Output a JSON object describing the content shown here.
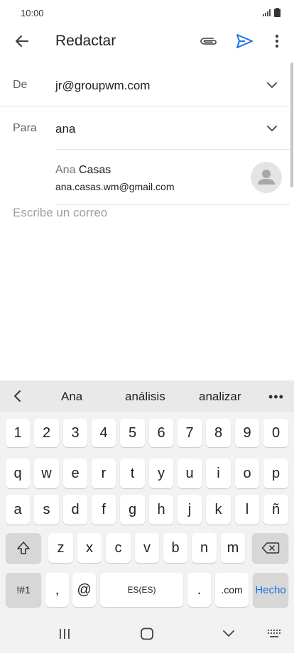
{
  "status_bar": {
    "time": "10:00"
  },
  "app_bar": {
    "title": "Redactar"
  },
  "from_field": {
    "label": "De",
    "value": "jr@groupwm.com"
  },
  "to_field": {
    "label": "Para",
    "value": "ana"
  },
  "suggestion": {
    "name_typed": "Ana",
    "name_rest": " Casas",
    "email": "ana.casas.wm@gmail.com"
  },
  "body": {
    "placeholder": "Escribe un correo"
  },
  "keyboard": {
    "suggestions": [
      "Ana",
      "análisis",
      "analizar"
    ],
    "more_label": "•••",
    "row_numbers": [
      "1",
      "2",
      "3",
      "4",
      "5",
      "6",
      "7",
      "8",
      "9",
      "0"
    ],
    "row1": [
      "q",
      "w",
      "e",
      "r",
      "t",
      "y",
      "u",
      "i",
      "o",
      "p"
    ],
    "row2": [
      "a",
      "s",
      "d",
      "f",
      "g",
      "h",
      "j",
      "k",
      "l",
      "ñ"
    ],
    "row3": [
      "z",
      "x",
      "c",
      "v",
      "b",
      "n",
      "m"
    ],
    "symbols_label": "!#1",
    "comma_label": ",",
    "at_label": "@",
    "space_label": "ES(ES)",
    "period_label": ".",
    "dotcom_label": ".com",
    "done_label": "Hecho"
  },
  "colors": {
    "accent": "#1a73e8",
    "keyboard_bg": "#f2f2f2",
    "key_bg": "#ffffff",
    "key_dark_bg": "#d7d7d7"
  }
}
